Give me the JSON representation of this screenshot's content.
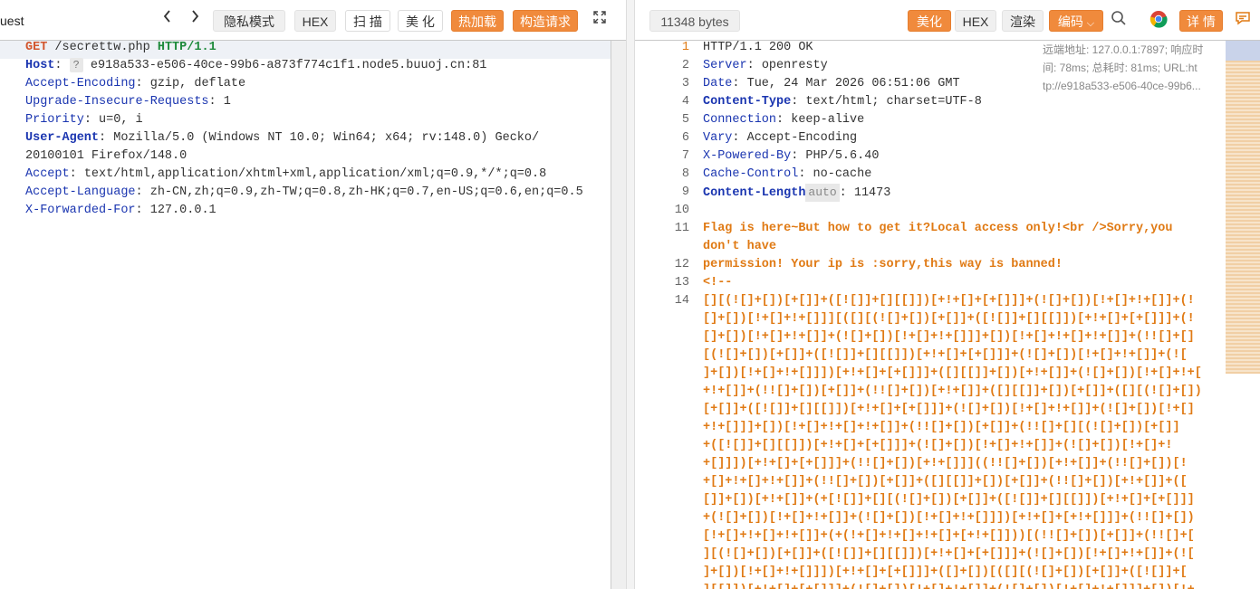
{
  "left": {
    "title": "uest",
    "buttons": {
      "private": "隐私模式",
      "hex": "HEX",
      "scan": "扫 描",
      "beautify": "美 化",
      "hotload": "热加载",
      "construct": "构造请求"
    },
    "request": {
      "method": "GET",
      "path": "/secrettw.php",
      "protocol": "HTTP/1.1",
      "headers": [
        {
          "name": "Host",
          "value": "e918a533-e506-40ce-99b6-a873f774c1f1.node5.buuoj.cn:81",
          "badge": "?"
        },
        {
          "name": "Accept-Encoding",
          "value": "gzip, deflate"
        },
        {
          "name": "Upgrade-Insecure-Requests",
          "value": "1"
        },
        {
          "name": "Priority",
          "value": "u=0, i"
        },
        {
          "name": "User-Agent",
          "value": "Mozilla/5.0 (Windows NT 10.0; Win64; x64; rv:148.0) Gecko/",
          "cont": "20100101 Firefox/148.0"
        },
        {
          "name": "Accept",
          "value": "text/html,application/xhtml+xml,application/xml;q=0.9,*/*;q=0.8"
        },
        {
          "name": "Accept-Language",
          "value": "zh-CN,zh;q=0.9,zh-TW;q=0.8,zh-HK;q=0.7,en-US;q=0.6,en;q=0.5"
        },
        {
          "name": "X-Forwarded-For",
          "value": "127.0.0.1"
        }
      ]
    }
  },
  "right": {
    "size": "11348 bytes",
    "buttons": {
      "beautify": "美化",
      "hex": "HEX",
      "render": "渲染",
      "encoding": "编码",
      "details": "详 情"
    },
    "info": {
      "line1": "远端地址: 127.0.0.1:7897; 响应时",
      "line2": "间: 78ms; 总耗时: 81ms; URL:ht",
      "line3": "tp://e918a533-e506-40ce-99b6..."
    },
    "line_numbers": [
      "1",
      "2",
      "3",
      "4",
      "5",
      "6",
      "7",
      "8",
      "9",
      "10",
      "11",
      "",
      "12",
      "13",
      "14"
    ],
    "status_line": "HTTP/1.1 200 OK",
    "headers": [
      {
        "name": "Server",
        "value": "openresty",
        "bold": false
      },
      {
        "name": "Date",
        "value": "Tue, 24 Mar 2026 06:51:06 GMT",
        "bold": false
      },
      {
        "name": "Content-Type",
        "value": "text/html; charset=UTF-8",
        "bold": true
      },
      {
        "name": "Connection",
        "value": "keep-alive",
        "bold": false
      },
      {
        "name": "Vary",
        "value": "Accept-Encoding",
        "bold": false
      },
      {
        "name": "X-Powered-By",
        "value": "PHP/5.6.40",
        "bold": false
      },
      {
        "name": "Cache-Control",
        "value": "no-cache",
        "bold": false
      }
    ],
    "content_length": {
      "name": "Content-Length",
      "badge": "auto",
      "value": "11473"
    },
    "body_lines": [
      "Flag is here~But how to get it?Local access only!<br />Sorry,you ",
      "don't have",
      "permission! Your ip is :sorry,this way is banned!",
      "<!--",
      "[][(![]+[])[+[]]+([![]]+[][[]])[+!+[]+[+[]]]+(![]+[])[!+[]+!+[]]+(!",
      "[]+[])[!+[]+!+[]]][([][(![]+[])[+[]]+([![]]+[][[]])[+!+[]+[+[]]]+(!",
      "[]+[])[!+[]+!+[]]+(![]+[])[!+[]+!+[]]]+[])[!+[]+!+[]+!+[]]+(!![]+[]",
      "[(![]+[])[+[]]+([![]]+[][[]])[+!+[]+[+[]]]+(![]+[])[!+[]+!+[]]+(![",
      "]+[])[!+[]+!+[]]])[+!+[]+[+[]]]+([][[]]+[])[+!+[]]+(![]+[])[!+[]+!+[",
      "+!+[]]+(!![]+[])[+[]]+(!![]+[])[+!+[]]+([][[]]+[])[+[]]+([][(![]+[])",
      "[+[]]+([![]]+[][[]])[+!+[]+[+[]]]+(![]+[])[!+[]+!+[]]+(![]+[])[!+[]",
      "+!+[]]]+[])[!+[]+!+[]+!+[]]+(!![]+[])[+[]]+(!![]+[][(![]+[])[+[]]",
      "+([![]]+[][[]])[+!+[]+[+[]]]+(![]+[])[!+[]+!+[]]+(![]+[])[!+[]+!",
      "+[]]])[+!+[]+[+[]]]+(!![]+[])[+!+[]]]((!![]+[])[+!+[]]+(!![]+[])[!",
      "+[]+!+[]+!+[]]+(!![]+[])[+[]]+([][[]]+[])[+[]]+(!![]+[])[+!+[]]+([",
      "[]]+[])[+!+[]]+(+[![]]+[][(![]+[])[+[]]+([![]]+[][[]])[+!+[]+[+[]]]",
      "+(![]+[])[!+[]+!+[]]+(![]+[])[!+[]+!+[]]])[+!+[]+[+!+[]]]+(!![]+[])",
      "[!+[]+!+[]+!+[]]+(+(!+[]+!+[]+!+[]+[+!+[]]))[(!![]+[])[+[]]+(!![]+[",
      "][(![]+[])[+[]]+([![]]+[][[]])[+!+[]+[+[]]]+(![]+[])[!+[]+!+[]]+(![",
      "]+[])[!+[]+!+[]]])[+!+[]+[+[]]]+([]+[])[([][(![]+[])[+[]]+([![]]+[",
      "][[]])[+!+[]+[+[]]]+(![]+[])[!+[]+!+[]]+(![]+[])[!+[]+!+[]]]+[])[!+"
    ]
  }
}
